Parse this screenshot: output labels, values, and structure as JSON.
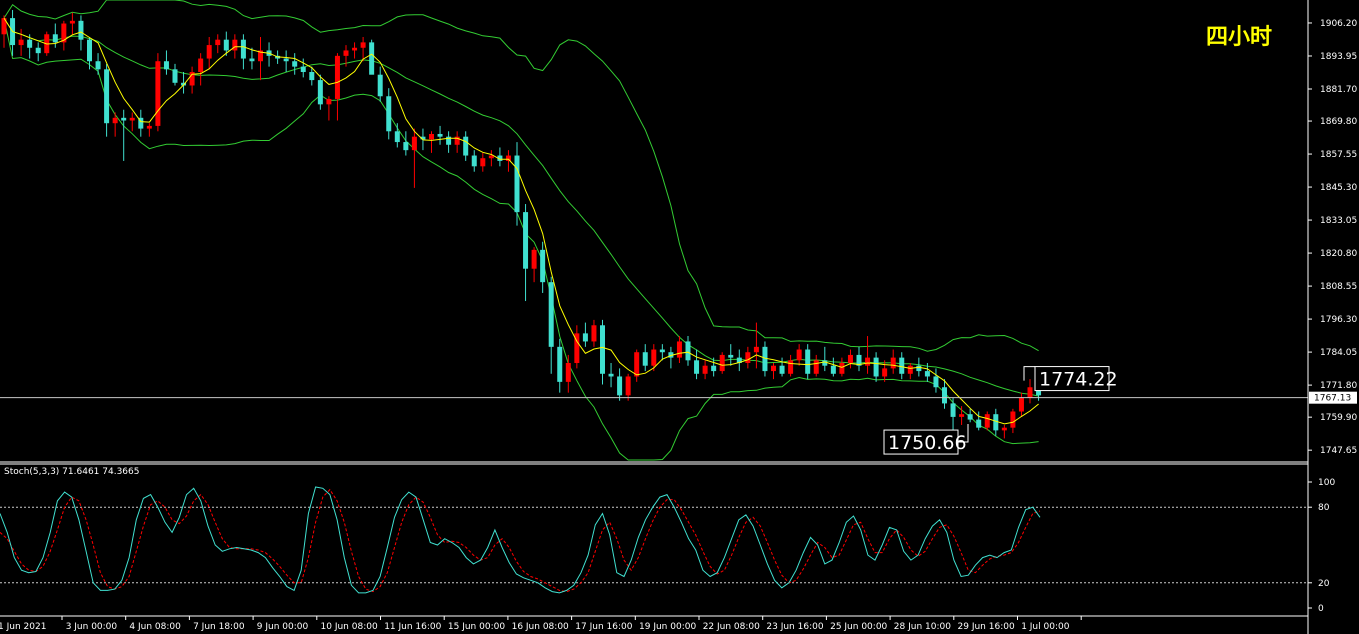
{
  "chart_data": [
    {
      "type": "candlestick",
      "timeframe_label": "四小时",
      "x_tick_labels": [
        "1 Jun 2021",
        "3 Jun 00:00",
        "4 Jun 08:00",
        "7 Jun 18:00",
        "9 Jun 00:00",
        "10 Jun 08:00",
        "11 Jun 16:00",
        "15 Jun 00:00",
        "16 Jun 08:00",
        "17 Jun 16:00",
        "19 Jun 00:00",
        "22 Jun 08:00",
        "23 Jun 16:00",
        "25 Jun 00:00",
        "28 Jun 10:00",
        "29 Jun 16:00",
        "1 Jul 00:00"
      ],
      "y_tick_labels": [
        "1906.20",
        "1893.95",
        "1881.70",
        "1869.80",
        "1857.55",
        "1845.30",
        "1833.05",
        "1820.80",
        "1808.55",
        "1796.30",
        "1784.05",
        "1771.80",
        "1759.90",
        "1747.65"
      ],
      "ylim": [
        1744.0,
        1912.5
      ],
      "current_price": "1767.13",
      "annotations": {
        "high_box": "1774.22",
        "low_box": "1750.66"
      },
      "colors": {
        "bull": "#ff0000",
        "bear": "#40e0d0",
        "ma": "#ffff00",
        "bands": "#33cc33",
        "bid_line": "#c8c8c8"
      },
      "candles": [
        [
          1902,
          1909,
          1897,
          1908
        ],
        [
          1908,
          1911,
          1894,
          1898
        ],
        [
          1898,
          1904,
          1894,
          1900
        ],
        [
          1900,
          1902,
          1893,
          1897
        ],
        [
          1897,
          1899,
          1892,
          1895
        ],
        [
          1895,
          1903,
          1894,
          1902
        ],
        [
          1902,
          1906,
          1897,
          1899
        ],
        [
          1899,
          1907,
          1896,
          1906
        ],
        [
          1906,
          1910,
          1902,
          1907
        ],
        [
          1907,
          1909,
          1896,
          1900
        ],
        [
          1900,
          1901,
          1889,
          1892
        ],
        [
          1892,
          1895,
          1887,
          1889
        ],
        [
          1889,
          1891,
          1864,
          1869
        ],
        [
          1869,
          1873,
          1864,
          1871
        ],
        [
          1871,
          1874,
          1855,
          1870
        ],
        [
          1870,
          1873,
          1866,
          1871
        ],
        [
          1871,
          1874,
          1864,
          1867
        ],
        [
          1867,
          1869,
          1864,
          1868
        ],
        [
          1868,
          1895,
          1866,
          1892
        ],
        [
          1892,
          1896,
          1887,
          1889
        ],
        [
          1889,
          1891,
          1883,
          1884
        ],
        [
          1884,
          1888,
          1880,
          1883
        ],
        [
          1883,
          1890,
          1880,
          1888
        ],
        [
          1888,
          1895,
          1883,
          1893
        ],
        [
          1893,
          1901,
          1889,
          1898
        ],
        [
          1898,
          1902,
          1895,
          1900
        ],
        [
          1900,
          1903,
          1894,
          1896
        ],
        [
          1896,
          1902,
          1893,
          1900
        ],
        [
          1900,
          1902,
          1889,
          1893
        ],
        [
          1893,
          1897,
          1889,
          1892
        ],
        [
          1892,
          1901,
          1885,
          1896
        ],
        [
          1896,
          1899,
          1890,
          1894
        ],
        [
          1894,
          1896,
          1891,
          1893
        ],
        [
          1893,
          1896,
          1888,
          1892
        ],
        [
          1892,
          1895,
          1887,
          1890
        ],
        [
          1890,
          1893,
          1886,
          1888
        ],
        [
          1888,
          1890,
          1883,
          1885
        ],
        [
          1885,
          1887,
          1874,
          1876
        ],
        [
          1876,
          1879,
          1870,
          1878
        ],
        [
          1878,
          1895,
          1870,
          1894
        ],
        [
          1894,
          1898,
          1890,
          1896
        ],
        [
          1896,
          1899,
          1893,
          1897
        ],
        [
          1897,
          1901,
          1892,
          1899
        ],
        [
          1899,
          1900,
          1890,
          1887
        ],
        [
          1887,
          1890,
          1877,
          1879
        ],
        [
          1879,
          1882,
          1863,
          1866
        ],
        [
          1866,
          1869,
          1860,
          1862
        ],
        [
          1862,
          1866,
          1857,
          1859
        ],
        [
          1859,
          1867,
          1845,
          1864
        ],
        [
          1864,
          1867,
          1859,
          1863
        ],
        [
          1863,
          1866,
          1858,
          1865
        ],
        [
          1865,
          1868,
          1861,
          1864
        ],
        [
          1864,
          1866,
          1858,
          1861
        ],
        [
          1861,
          1866,
          1858,
          1864
        ],
        [
          1864,
          1866,
          1855,
          1857
        ],
        [
          1857,
          1859,
          1851,
          1853
        ],
        [
          1853,
          1858,
          1851,
          1856
        ],
        [
          1856,
          1859,
          1853,
          1857
        ],
        [
          1857,
          1860,
          1853,
          1855
        ],
        [
          1855,
          1859,
          1851,
          1857
        ],
        [
          1857,
          1862,
          1831,
          1836
        ],
        [
          1836,
          1839,
          1803,
          1815
        ],
        [
          1815,
          1823,
          1810,
          1822
        ],
        [
          1822,
          1825,
          1806,
          1810
        ],
        [
          1810,
          1812,
          1776,
          1786
        ],
        [
          1786,
          1789,
          1769,
          1773
        ],
        [
          1773,
          1783,
          1769,
          1780
        ],
        [
          1780,
          1794,
          1778,
          1791
        ],
        [
          1791,
          1795,
          1786,
          1788
        ],
        [
          1788,
          1796,
          1786,
          1794
        ],
        [
          1794,
          1796,
          1772,
          1776
        ],
        [
          1776,
          1780,
          1771,
          1775
        ],
        [
          1775,
          1778,
          1766,
          1768
        ],
        [
          1768,
          1776,
          1766,
          1775
        ],
        [
          1775,
          1785,
          1773,
          1784
        ],
        [
          1784,
          1787,
          1777,
          1779
        ],
        [
          1779,
          1787,
          1777,
          1785
        ],
        [
          1785,
          1787,
          1781,
          1784
        ],
        [
          1784,
          1786,
          1778,
          1782
        ],
        [
          1782,
          1790,
          1780,
          1788
        ],
        [
          1788,
          1790,
          1779,
          1781
        ],
        [
          1781,
          1785,
          1774,
          1776
        ],
        [
          1776,
          1781,
          1774,
          1779
        ],
        [
          1779,
          1782,
          1775,
          1777
        ],
        [
          1777,
          1784,
          1776,
          1783
        ],
        [
          1783,
          1787,
          1779,
          1782
        ],
        [
          1782,
          1785,
          1777,
          1780
        ],
        [
          1780,
          1786,
          1778,
          1784
        ],
        [
          1784,
          1795,
          1778,
          1786
        ],
        [
          1786,
          1788,
          1775,
          1777
        ],
        [
          1777,
          1780,
          1774,
          1779
        ],
        [
          1779,
          1782,
          1775,
          1776
        ],
        [
          1776,
          1783,
          1775,
          1781
        ],
        [
          1781,
          1787,
          1779,
          1785
        ],
        [
          1785,
          1787,
          1774,
          1776
        ],
        [
          1776,
          1783,
          1775,
          1781
        ],
        [
          1781,
          1786,
          1777,
          1779
        ],
        [
          1779,
          1782,
          1775,
          1776
        ],
        [
          1776,
          1782,
          1775,
          1780
        ],
        [
          1780,
          1785,
          1778,
          1783
        ],
        [
          1783,
          1786,
          1777,
          1779
        ],
        [
          1779,
          1790,
          1776,
          1782
        ],
        [
          1782,
          1784,
          1773,
          1775
        ],
        [
          1775,
          1781,
          1773,
          1778
        ],
        [
          1778,
          1785,
          1776,
          1782
        ],
        [
          1782,
          1784,
          1774,
          1776
        ],
        [
          1776,
          1780,
          1774,
          1779
        ],
        [
          1779,
          1782,
          1775,
          1777
        ],
        [
          1777,
          1780,
          1773,
          1775
        ],
        [
          1775,
          1778,
          1769,
          1771
        ],
        [
          1771,
          1774,
          1763,
          1765
        ],
        [
          1765,
          1767,
          1752,
          1760
        ],
        [
          1760,
          1764,
          1757,
          1761
        ],
        [
          1761,
          1763,
          1758,
          1759
        ],
        [
          1759,
          1762,
          1755,
          1756
        ],
        [
          1756,
          1762,
          1755,
          1761
        ],
        [
          1761,
          1763,
          1753,
          1755
        ],
        [
          1755,
          1757,
          1752,
          1756
        ],
        [
          1756,
          1763,
          1754,
          1762
        ],
        [
          1762,
          1769,
          1760,
          1767
        ],
        [
          1767,
          1774,
          1765,
          1771
        ],
        [
          1771,
          1774,
          1766,
          1768
        ]
      ]
    },
    {
      "type": "line",
      "indicator_label": "Stoch(5,3,3) 71.6461 74.3665",
      "y_tick_labels": [
        "100",
        "80",
        "20",
        "0"
      ],
      "ylim": [
        0,
        100
      ],
      "levels": [
        20,
        80
      ],
      "colors": {
        "main": "#40e0d0",
        "signal": "#ff0000"
      },
      "series": [
        {
          "values": [
            75,
            60,
            40,
            30,
            28,
            29,
            40,
            60,
            85,
            92,
            88,
            70,
            45,
            20,
            14,
            14,
            15,
            22,
            40,
            70,
            87,
            90,
            80,
            68,
            60,
            72,
            90,
            95,
            85,
            65,
            50,
            45,
            47,
            48,
            47,
            46,
            44,
            40,
            32,
            25,
            17,
            14,
            30,
            75,
            96,
            95,
            90,
            70,
            40,
            18,
            12,
            12,
            14,
            25,
            48,
            72,
            86,
            92,
            88,
            70,
            52,
            50,
            55,
            52,
            48,
            40,
            35,
            38,
            48,
            62,
            48,
            36,
            27,
            24,
            22,
            20,
            16,
            13,
            12,
            14,
            18,
            28,
            42,
            66,
            75,
            58,
            28,
            25,
            38,
            56,
            70,
            80,
            88,
            90,
            80,
            68,
            55,
            46,
            30,
            25,
            28,
            40,
            55,
            70,
            74,
            65,
            50,
            35,
            22,
            16,
            20,
            30,
            44,
            56,
            50,
            35,
            38,
            52,
            68,
            73,
            62,
            42,
            38,
            50,
            64,
            62,
            45,
            38,
            42,
            55,
            65,
            70,
            60,
            38,
            25,
            26,
            34,
            40,
            42,
            40,
            44,
            46,
            64,
            78,
            80,
            72
          ]
        },
        {
          "values": [
            60,
            55,
            45,
            35,
            30,
            29,
            33,
            45,
            62,
            80,
            88,
            85,
            70,
            50,
            28,
            17,
            15,
            17,
            25,
            45,
            65,
            82,
            85,
            80,
            70,
            67,
            73,
            85,
            90,
            82,
            68,
            55,
            48,
            47,
            47,
            47,
            46,
            44,
            39,
            33,
            26,
            20,
            20,
            40,
            68,
            88,
            94,
            85,
            68,
            45,
            25,
            15,
            13,
            17,
            28,
            48,
            68,
            82,
            88,
            84,
            72,
            58,
            52,
            53,
            52,
            48,
            42,
            38,
            40,
            50,
            55,
            48,
            37,
            29,
            25,
            23,
            20,
            17,
            14,
            13,
            15,
            20,
            28,
            45,
            62,
            68,
            55,
            38,
            30,
            40,
            55,
            69,
            80,
            86,
            86,
            78,
            68,
            58,
            45,
            33,
            27,
            30,
            42,
            56,
            68,
            72,
            65,
            52,
            38,
            26,
            20,
            22,
            31,
            42,
            52,
            48,
            40,
            42,
            54,
            66,
            68,
            55,
            44,
            44,
            55,
            62,
            56,
            46,
            41,
            45,
            55,
            64,
            66,
            57,
            44,
            30,
            28,
            34,
            39,
            41,
            42,
            44,
            52,
            64,
            75,
            77
          ]
        }
      ]
    }
  ]
}
